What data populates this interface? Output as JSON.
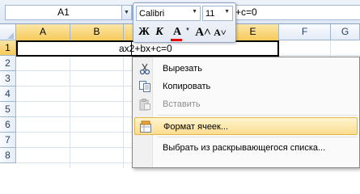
{
  "formula_bar": {
    "name_box": "A1",
    "formula": "+c=0"
  },
  "columns": [
    "A",
    "B",
    "C",
    "D",
    "E",
    "F",
    "G"
  ],
  "rows": [
    "1",
    "2",
    "3",
    "4",
    "5",
    "6",
    "7",
    "8"
  ],
  "cell": {
    "address": "A1",
    "value": "ax2+bx+c=0"
  },
  "mini_toolbar": {
    "font": "Calibri",
    "size": "11",
    "bold": "Ж",
    "italic": "К",
    "font_color": "A",
    "grow": "A˄",
    "shrink": "A˅",
    "font_color_hex": "#e60000"
  },
  "context_menu": {
    "items": [
      {
        "label": "Вырезать",
        "icon": "scissors-icon",
        "enabled": true
      },
      {
        "label": "Копировать",
        "icon": "copy-icon",
        "enabled": true
      },
      {
        "label": "Вставить",
        "icon": "paste-icon",
        "enabled": false
      },
      {
        "label": "Формат ячеек...",
        "icon": "format-cells-icon",
        "enabled": true,
        "highlighted": true
      },
      {
        "label": "Выбрать из раскрывающегося списка...",
        "icon": "",
        "enabled": true
      }
    ]
  },
  "colors": {
    "selection_header": "#f7c95a",
    "menu_highlight": "#fbdd8f",
    "grid_line": "#dae3ee"
  }
}
